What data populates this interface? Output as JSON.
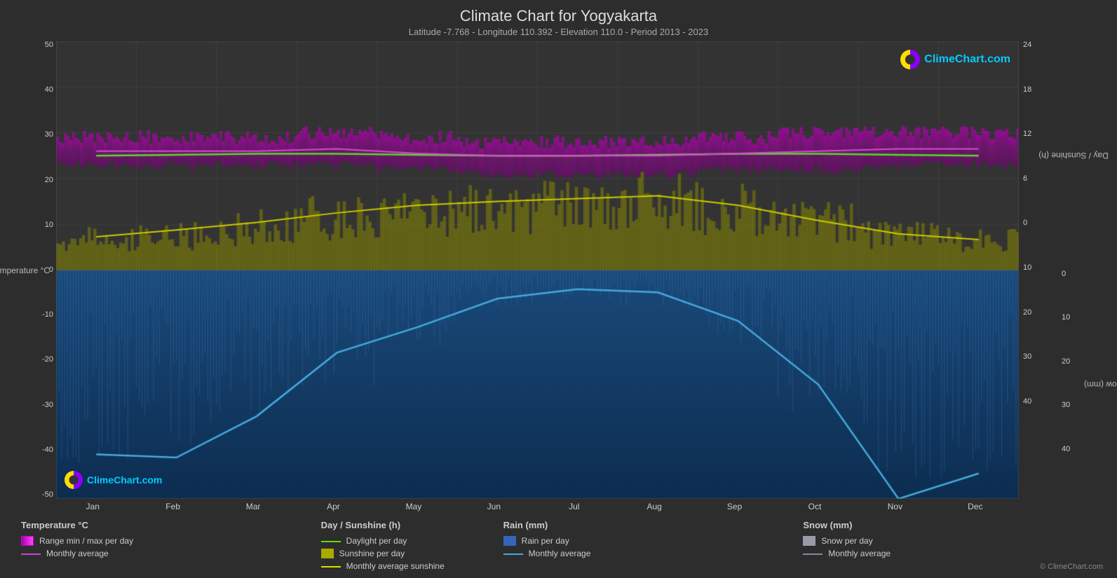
{
  "title": "Climate Chart for Yogyakarta",
  "subtitle": "Latitude -7.768 - Longitude 110.392 - Elevation 110.0 - Period 2013 - 2023",
  "logo_top": "ClimeChart.com",
  "logo_bottom": "ClimeChart.com",
  "copyright": "© ClimeChart.com",
  "axes": {
    "left_label": "Temperature °C",
    "right1_label": "Day / Sunshine (h)",
    "right2_label": "Rain / Snow (mm)",
    "left_ticks": [
      "50",
      "40",
      "30",
      "20",
      "10",
      "0",
      "-10",
      "-20",
      "-30",
      "-40",
      "-50"
    ],
    "right1_ticks": [
      "24",
      "18",
      "12",
      "6",
      "0"
    ],
    "right2_ticks": [
      "0",
      "10",
      "20",
      "30",
      "40"
    ],
    "x_months": [
      "Jan",
      "Feb",
      "Mar",
      "Apr",
      "May",
      "Jun",
      "Jul",
      "Aug",
      "Sep",
      "Oct",
      "Nov",
      "Dec"
    ]
  },
  "legend": {
    "col1": {
      "title": "Temperature °C",
      "items": [
        {
          "type": "swatch",
          "color": "#cc00cc",
          "label": "Range min / max per day"
        },
        {
          "type": "line",
          "color": "#cc44cc",
          "label": "Monthly average"
        }
      ]
    },
    "col2": {
      "title": "Day / Sunshine (h)",
      "items": [
        {
          "type": "line",
          "color": "#66dd00",
          "label": "Daylight per day"
        },
        {
          "type": "swatch",
          "color": "#aaaa00",
          "label": "Sunshine per day"
        },
        {
          "type": "line",
          "color": "#dddd00",
          "label": "Monthly average sunshine"
        }
      ]
    },
    "col3": {
      "title": "Rain (mm)",
      "items": [
        {
          "type": "swatch",
          "color": "#4488cc",
          "label": "Rain per day"
        },
        {
          "type": "line",
          "color": "#44aadd",
          "label": "Monthly average"
        }
      ]
    },
    "col4": {
      "title": "Snow (mm)",
      "items": [
        {
          "type": "swatch",
          "color": "#aaaacc",
          "label": "Snow per day"
        },
        {
          "type": "line",
          "color": "#888899",
          "label": "Monthly average"
        }
      ]
    }
  }
}
